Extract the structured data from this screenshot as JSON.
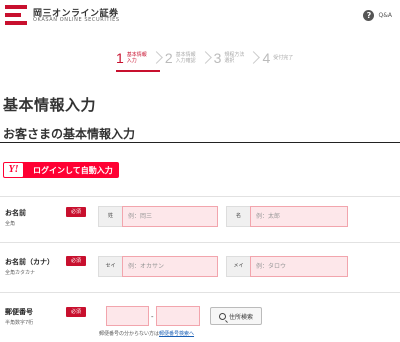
{
  "header": {
    "brand_name": "岡三オンライン証券",
    "brand_sub": "OKASAN ONLINE SECURITIES",
    "qa_label": "Q&A",
    "brand_color": "#c8102e"
  },
  "steps": [
    {
      "num": "1",
      "text": "基本情報\n入力",
      "active": true
    },
    {
      "num": "2",
      "text": "基本情報\n入力確認",
      "active": false
    },
    {
      "num": "3",
      "text": "規程方法\n選択",
      "active": false
    },
    {
      "num": "4",
      "text": "受付完了",
      "active": false
    }
  ],
  "page_title": "基本情報入力",
  "section_title": "お客さまの基本情報入力",
  "yahoo": {
    "mark": "Y!",
    "label": "ログインして自動入力",
    "color": "#ff0033"
  },
  "form": {
    "required_badge": "必須",
    "name": {
      "label": "お名前",
      "sub": "全角",
      "last_prefix": "姓",
      "last_placeholder": "例：岡三",
      "first_prefix": "名",
      "first_placeholder": "例：太郎"
    },
    "kana": {
      "label": "お名前（カナ）",
      "sub": "全角カタカナ",
      "last_prefix": "セイ",
      "last_placeholder": "例：オカサン",
      "first_prefix": "メイ",
      "first_placeholder": "例：タロウ"
    },
    "zip": {
      "label": "郵便番号",
      "sub": "半角数字7桁",
      "mark": "〒",
      "dash": "-",
      "search_label": "住所検索",
      "note_text": "郵便番号の分からない方は",
      "note_link": "郵便番号検索へ"
    }
  }
}
